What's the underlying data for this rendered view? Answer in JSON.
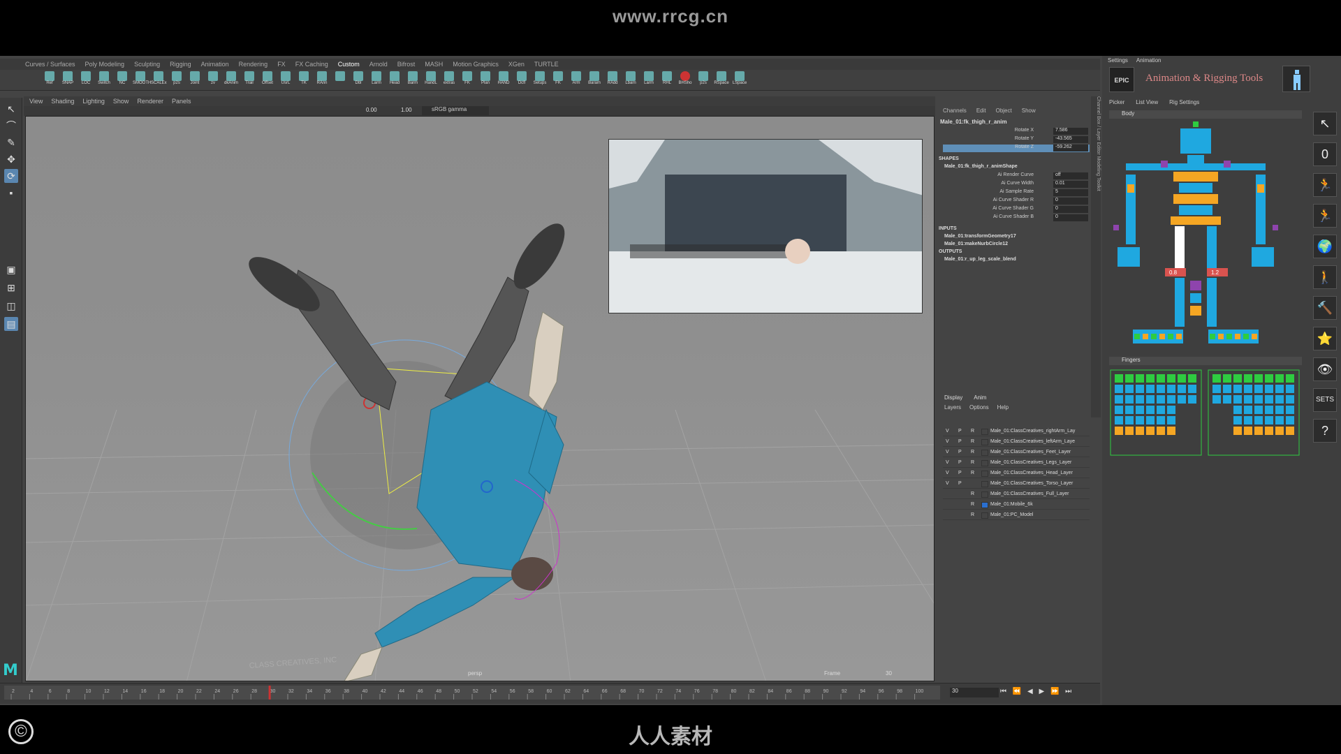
{
  "overlay": {
    "url": "www.rrcg.cn",
    "bottom_brand": "人人素材",
    "copyright_symbol": "©"
  },
  "shelf_tabs": [
    "Curves / Surfaces",
    "Poly Modeling",
    "Sculpting",
    "Rigging",
    "Animation",
    "Rendering",
    "FX",
    "FX Caching",
    "Custom",
    "Arnold",
    "Bifrost",
    "MASH",
    "Motion Graphics",
    "XGen",
    "TURTLE"
  ],
  "shelf_active": "Custom",
  "shelf_buttons": [
    "Ref",
    "SNAP",
    "LOC",
    "Switch",
    "NC",
    "SMOOTH",
    "SCALEx",
    "p2s",
    "Joint",
    "zv",
    "dkAnim",
    "Trail",
    "Offset",
    "UsrL",
    "TK",
    "RAnn",
    "",
    "Dbl",
    "Larm",
    "Head",
    "Barm",
    "HandL",
    "extras",
    "FK",
    "Plan",
    "HAND",
    "Dcfl",
    "Setups",
    "FK",
    "Arm",
    "Baram",
    "RAdd",
    "Lbarn",
    "Larm",
    "RHL",
    "BHSho",
    "p2s",
    "RSpace",
    "LSpace"
  ],
  "viewport_menu": [
    "View",
    "Shading",
    "Lighting",
    "Show",
    "Renderer",
    "Panels"
  ],
  "viewport_toolbar": {
    "value_a": "0.00",
    "value_b": "1.00",
    "colorspace": "sRGB gamma"
  },
  "viewport_labels": {
    "camera": "persp",
    "frame_label": "Frame",
    "frame_value": "30",
    "floor_text": "CLASS CREATIVES, INC"
  },
  "channel_box": {
    "menu": [
      "Channels",
      "Edit",
      "Object",
      "Show"
    ],
    "node": "Male_01:fk_thigh_r_anim",
    "attributes": [
      {
        "label": "Rotate X",
        "value": "7.586"
      },
      {
        "label": "Rotate Y",
        "value": "-43.565"
      },
      {
        "label": "Rotate Z",
        "value": "-59.262"
      }
    ],
    "shapes_header": "SHAPES",
    "shape_node": "Male_01:fk_thigh_r_animShape",
    "shape_attributes": [
      {
        "label": "Ai Render Curve",
        "value": "off"
      },
      {
        "label": "Ai Curve Width",
        "value": "0.01"
      },
      {
        "label": "Ai Sample Rate",
        "value": "5"
      },
      {
        "label": "Ai Curve Shader R",
        "value": "0"
      },
      {
        "label": "Ai Curve Shader G",
        "value": "0"
      },
      {
        "label": "Ai Curve Shader B",
        "value": "0"
      }
    ],
    "inputs_header": "INPUTS",
    "inputs": [
      "Male_01:transformGeometry17",
      "Male_01:makeNurbCircle12"
    ],
    "outputs_header": "OUTPUTS",
    "outputs": [
      "Male_01:r_up_leg_scale_blend"
    ],
    "side_tabs": "Channel Box / Layer Editor    Modeling Toolkit"
  },
  "layer_editor": {
    "tabs": [
      "Display",
      "Anim"
    ],
    "menu": [
      "Layers",
      "Options",
      "Help"
    ],
    "layers": [
      {
        "v": "V",
        "p": "P",
        "r": "R",
        "name": "Male_01:ClassCreatives_rightArm_Lay"
      },
      {
        "v": "V",
        "p": "P",
        "r": "R",
        "name": "Male_01:ClassCreatives_leftArm_Laye"
      },
      {
        "v": "V",
        "p": "P",
        "r": "R",
        "name": "Male_01:ClassCreatives_Feet_Layer"
      },
      {
        "v": "V",
        "p": "P",
        "r": "R",
        "name": "Male_01:ClassCreatives_Legs_Layer"
      },
      {
        "v": "V",
        "p": "P",
        "r": "R",
        "name": "Male_01:ClassCreatives_Head_Layer"
      },
      {
        "v": "V",
        "p": "P",
        "r": "",
        "name": "Male_01:ClassCreatives_Torso_Layer"
      },
      {
        "v": "",
        "p": "",
        "r": "R",
        "name": "Male_01:ClassCreatives_Full_Layer"
      },
      {
        "v": "",
        "p": "",
        "r": "R",
        "name": "Male_01:Mobile_6k"
      },
      {
        "v": "",
        "p": "",
        "r": "R",
        "name": "Male_01:PC_Model"
      }
    ]
  },
  "timeline": {
    "ticks": [
      "2",
      "4",
      "6",
      "8",
      "10",
      "12",
      "14",
      "16",
      "18",
      "20",
      "22",
      "24",
      "26",
      "28",
      "30",
      "32",
      "34",
      "36",
      "38",
      "40",
      "42",
      "44",
      "46",
      "48",
      "50",
      "52",
      "54",
      "56",
      "58",
      "60",
      "62",
      "64",
      "66",
      "68",
      "70",
      "72",
      "74",
      "76",
      "78",
      "80",
      "82",
      "84",
      "86",
      "88",
      "90",
      "92",
      "94",
      "96",
      "98",
      "100"
    ],
    "current_frame": "30",
    "range_value": "30",
    "playback_glyphs": "⏮ ⏪ ◀ ▶ ⏩ ⏭"
  },
  "picker": {
    "menu": [
      "Settings",
      "Animation"
    ],
    "logo_text": "EPIC",
    "title": "Animation & Rigging Tools",
    "tabs": [
      "Picker",
      "List View",
      "Rig Settings"
    ],
    "body_header": "Body",
    "fingers_header": "Fingers",
    "leg_values": [
      "0.8",
      "1.2"
    ],
    "side_buttons": [
      "↖",
      "0",
      "🏃",
      "🏃",
      "🌍",
      "🚶",
      "🔨",
      "⭐",
      "👁",
      "SETS",
      "?"
    ],
    "colors": {
      "blue": "#1fa8e0",
      "orange": "#f5a623",
      "green": "#2ecc40",
      "purple": "#8e44ad",
      "white": "#ffffff",
      "red": "#d9534f"
    }
  }
}
